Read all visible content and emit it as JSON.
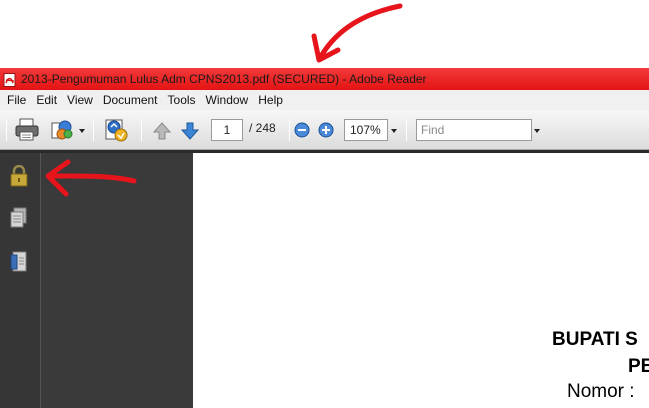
{
  "window": {
    "title": "2013-Pengumuman Lulus Adm CPNS2013.pdf (SECURED) - Adobe Reader",
    "titlebar_color": "#e81a1a"
  },
  "menu": {
    "items": [
      "File",
      "Edit",
      "View",
      "Document",
      "Tools",
      "Window",
      "Help"
    ]
  },
  "toolbar": {
    "icons": [
      "printer-icon",
      "share-icon",
      "collaborate-icon",
      "arrow-up-icon",
      "arrow-down-icon",
      "zoom-out-icon",
      "zoom-in-icon"
    ],
    "page_current": "1",
    "page_total": "/ 248",
    "zoom_value": "107%",
    "find_placeholder": "Find"
  },
  "sidebar": {
    "icons": [
      "lock-icon",
      "pages-icon",
      "attachments-icon"
    ]
  },
  "document": {
    "lines": [
      "BUPATI S",
      "PE",
      "Nomor :"
    ]
  },
  "annotations": {
    "color": "#e8141c",
    "shapes": [
      "red-arrow-title",
      "red-arrow-lock"
    ]
  }
}
